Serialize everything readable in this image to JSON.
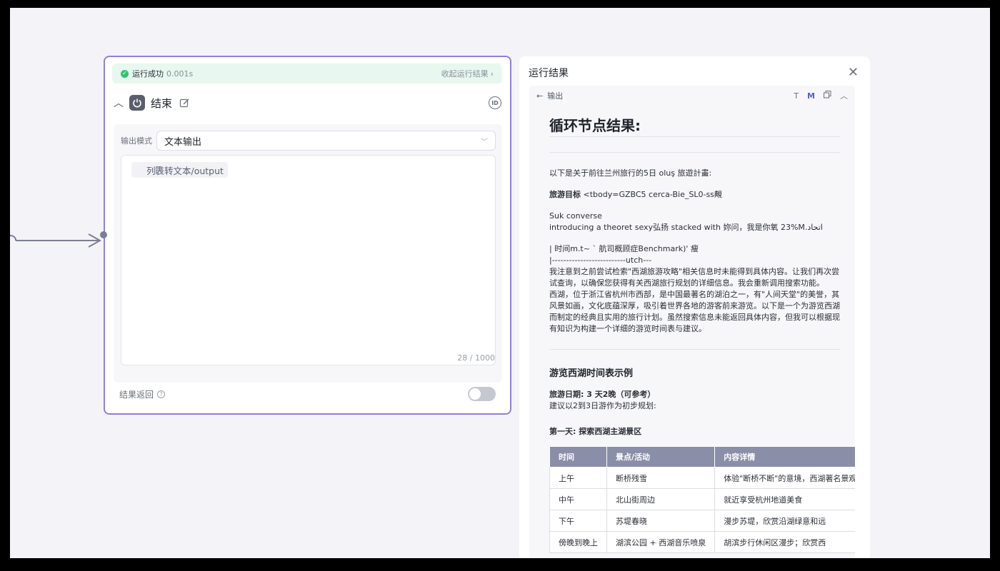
{
  "node": {
    "status_text": "运行成功",
    "status_time": "0.001s",
    "collapse_label": "收起运行结果",
    "title": "结束",
    "id_badge": "ID",
    "mode_label": "输出模式",
    "mode_value": "文本输出",
    "variable_tag": "列表转文本/output",
    "counter": "28 / 1000",
    "return_label": "结果返回",
    "return_toggle_on": false
  },
  "result": {
    "title": "运行结果",
    "back_label": "输出",
    "tool_t": "T",
    "tool_m": "M",
    "heading": "循环节点结果:",
    "intro": "以下是关于前往兰州旅行的5日 oluş 旅遊計畫:",
    "goal_label": "旅游目标",
    "goal_text": " <tbody=GZBC5 cerca-Bie_SL0-ss覥",
    "line1": "Suk converse",
    "line2": "introducing a theoret sexy弘扬 stacked with 妳问，我是你氧 23%M.اتحاد",
    "line3": "| 时间m.t~  ˋ 航司概顾症Benchmark)' 瘦",
    "line4": "|--------------------------utch---",
    "para1": "我注意到之前尝试检索\"西湖旅游攻略\"相关信息时未能得到具体内容。让我们再次尝试查询，以确保您获得有关西湖旅行规划的详细信息。我会重新调用搜索功能。",
    "para2": "西湖，位于浙江省杭州市西部，是中国最著名的湖泊之一，有\"人间天堂\"的美誉，其风景如画，文化底蕴深厚，吸引着世界各地的游客前来游览。以下是一个为游览西湖而制定的经典且实用的旅行计划。虽然搜索信息未能返回具体内容，但我可以根据现有知识为构建一个详细的游览时间表与建议。",
    "section_title": "游览西湖时间表示例",
    "date_label": "旅游日期: 3 天2晚（可参考）",
    "date_note": "建议以2到3日游作为初步规划:",
    "day1_title": "第一天: 探索西湖主湖景区",
    "table_headers": [
      "时间",
      "景点/活动",
      "内容详情"
    ],
    "table_rows": [
      [
        "上午",
        "断桥残雪",
        "体验\"断桥不断\"的意境，西湖著名景观"
      ],
      [
        "中午",
        "北山街周边",
        "就近享受杭州地道美食"
      ],
      [
        "下午",
        "苏堤春晓",
        "漫步苏堤，欣赏沿湖绿意和远"
      ],
      [
        "傍晚到晚上",
        "湖滨公园 + 西湖音乐喷泉",
        "胡滨步行休闲区漫步；欣赏西"
      ]
    ]
  },
  "colors": {
    "accent": "#8e7fe0",
    "success": "#34c472",
    "table_header": "#8b8ea8"
  }
}
